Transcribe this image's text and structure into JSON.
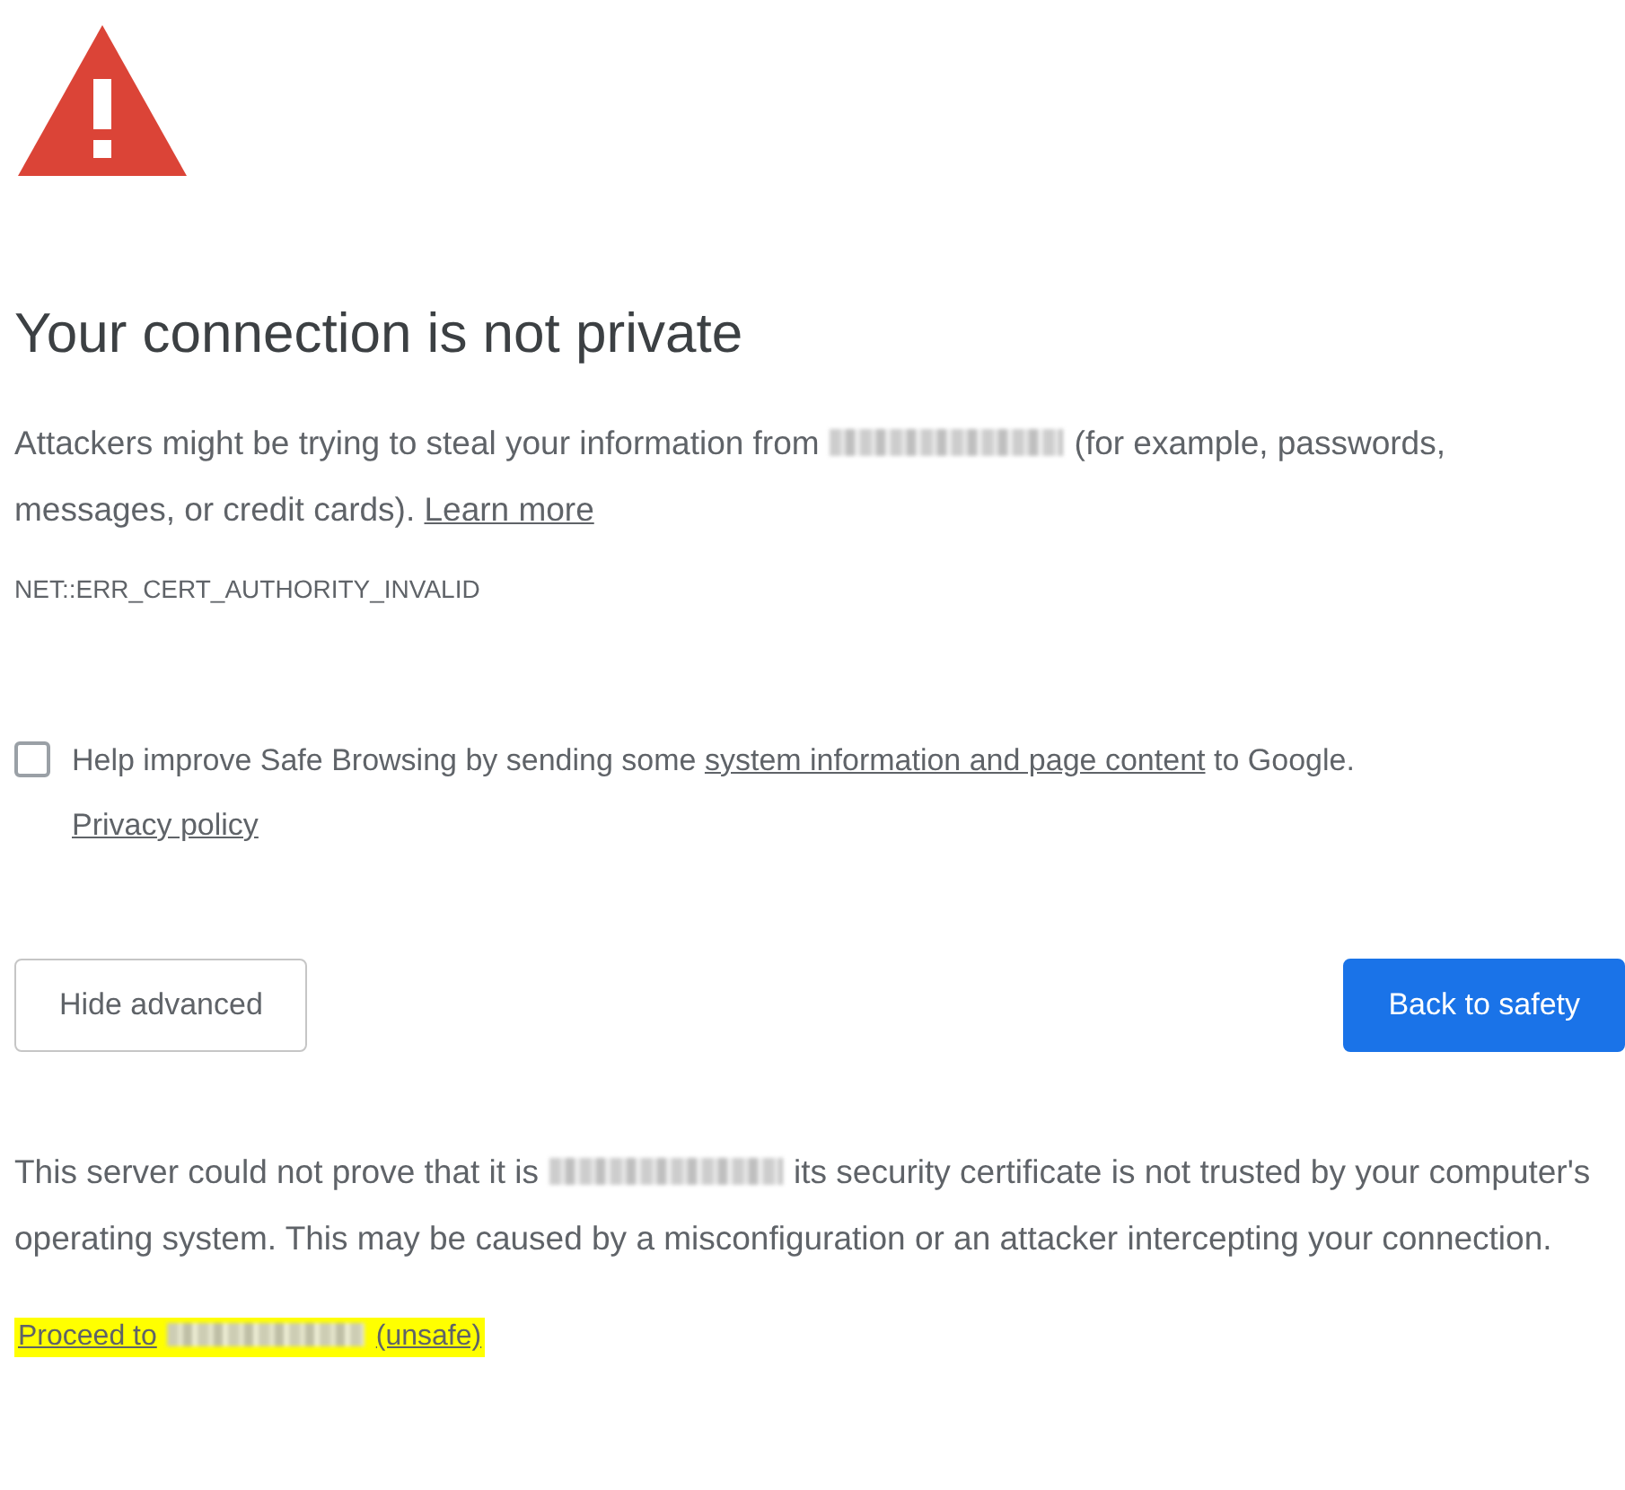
{
  "heading": "Your connection is not private",
  "intro": {
    "before": "Attackers might be trying to steal your information from",
    "after": "(for example, passwords, messages, or credit cards).",
    "link": "Learn more"
  },
  "error_code": "NET::ERR_CERT_AUTHORITY_INVALID",
  "safe_browsing": {
    "checked": false,
    "before": "Help improve Safe Browsing by sending some",
    "link": "system information and page content",
    "after": "to Google.",
    "policy_link": "Privacy policy"
  },
  "buttons": [
    {
      "label": "Hide advanced",
      "kind": "secondary"
    },
    {
      "label": "Back to safety",
      "kind": "primary"
    }
  ],
  "details": {
    "before": "This server could not prove that it is",
    "after": "its security certificate is not trusted by your computer's operating system. This may be caused by a misconfiguration or an attacker intercepting your connection."
  },
  "proceed": {
    "before": "Proceed to",
    "after": "(unsafe)",
    "highlighted": true
  }
}
